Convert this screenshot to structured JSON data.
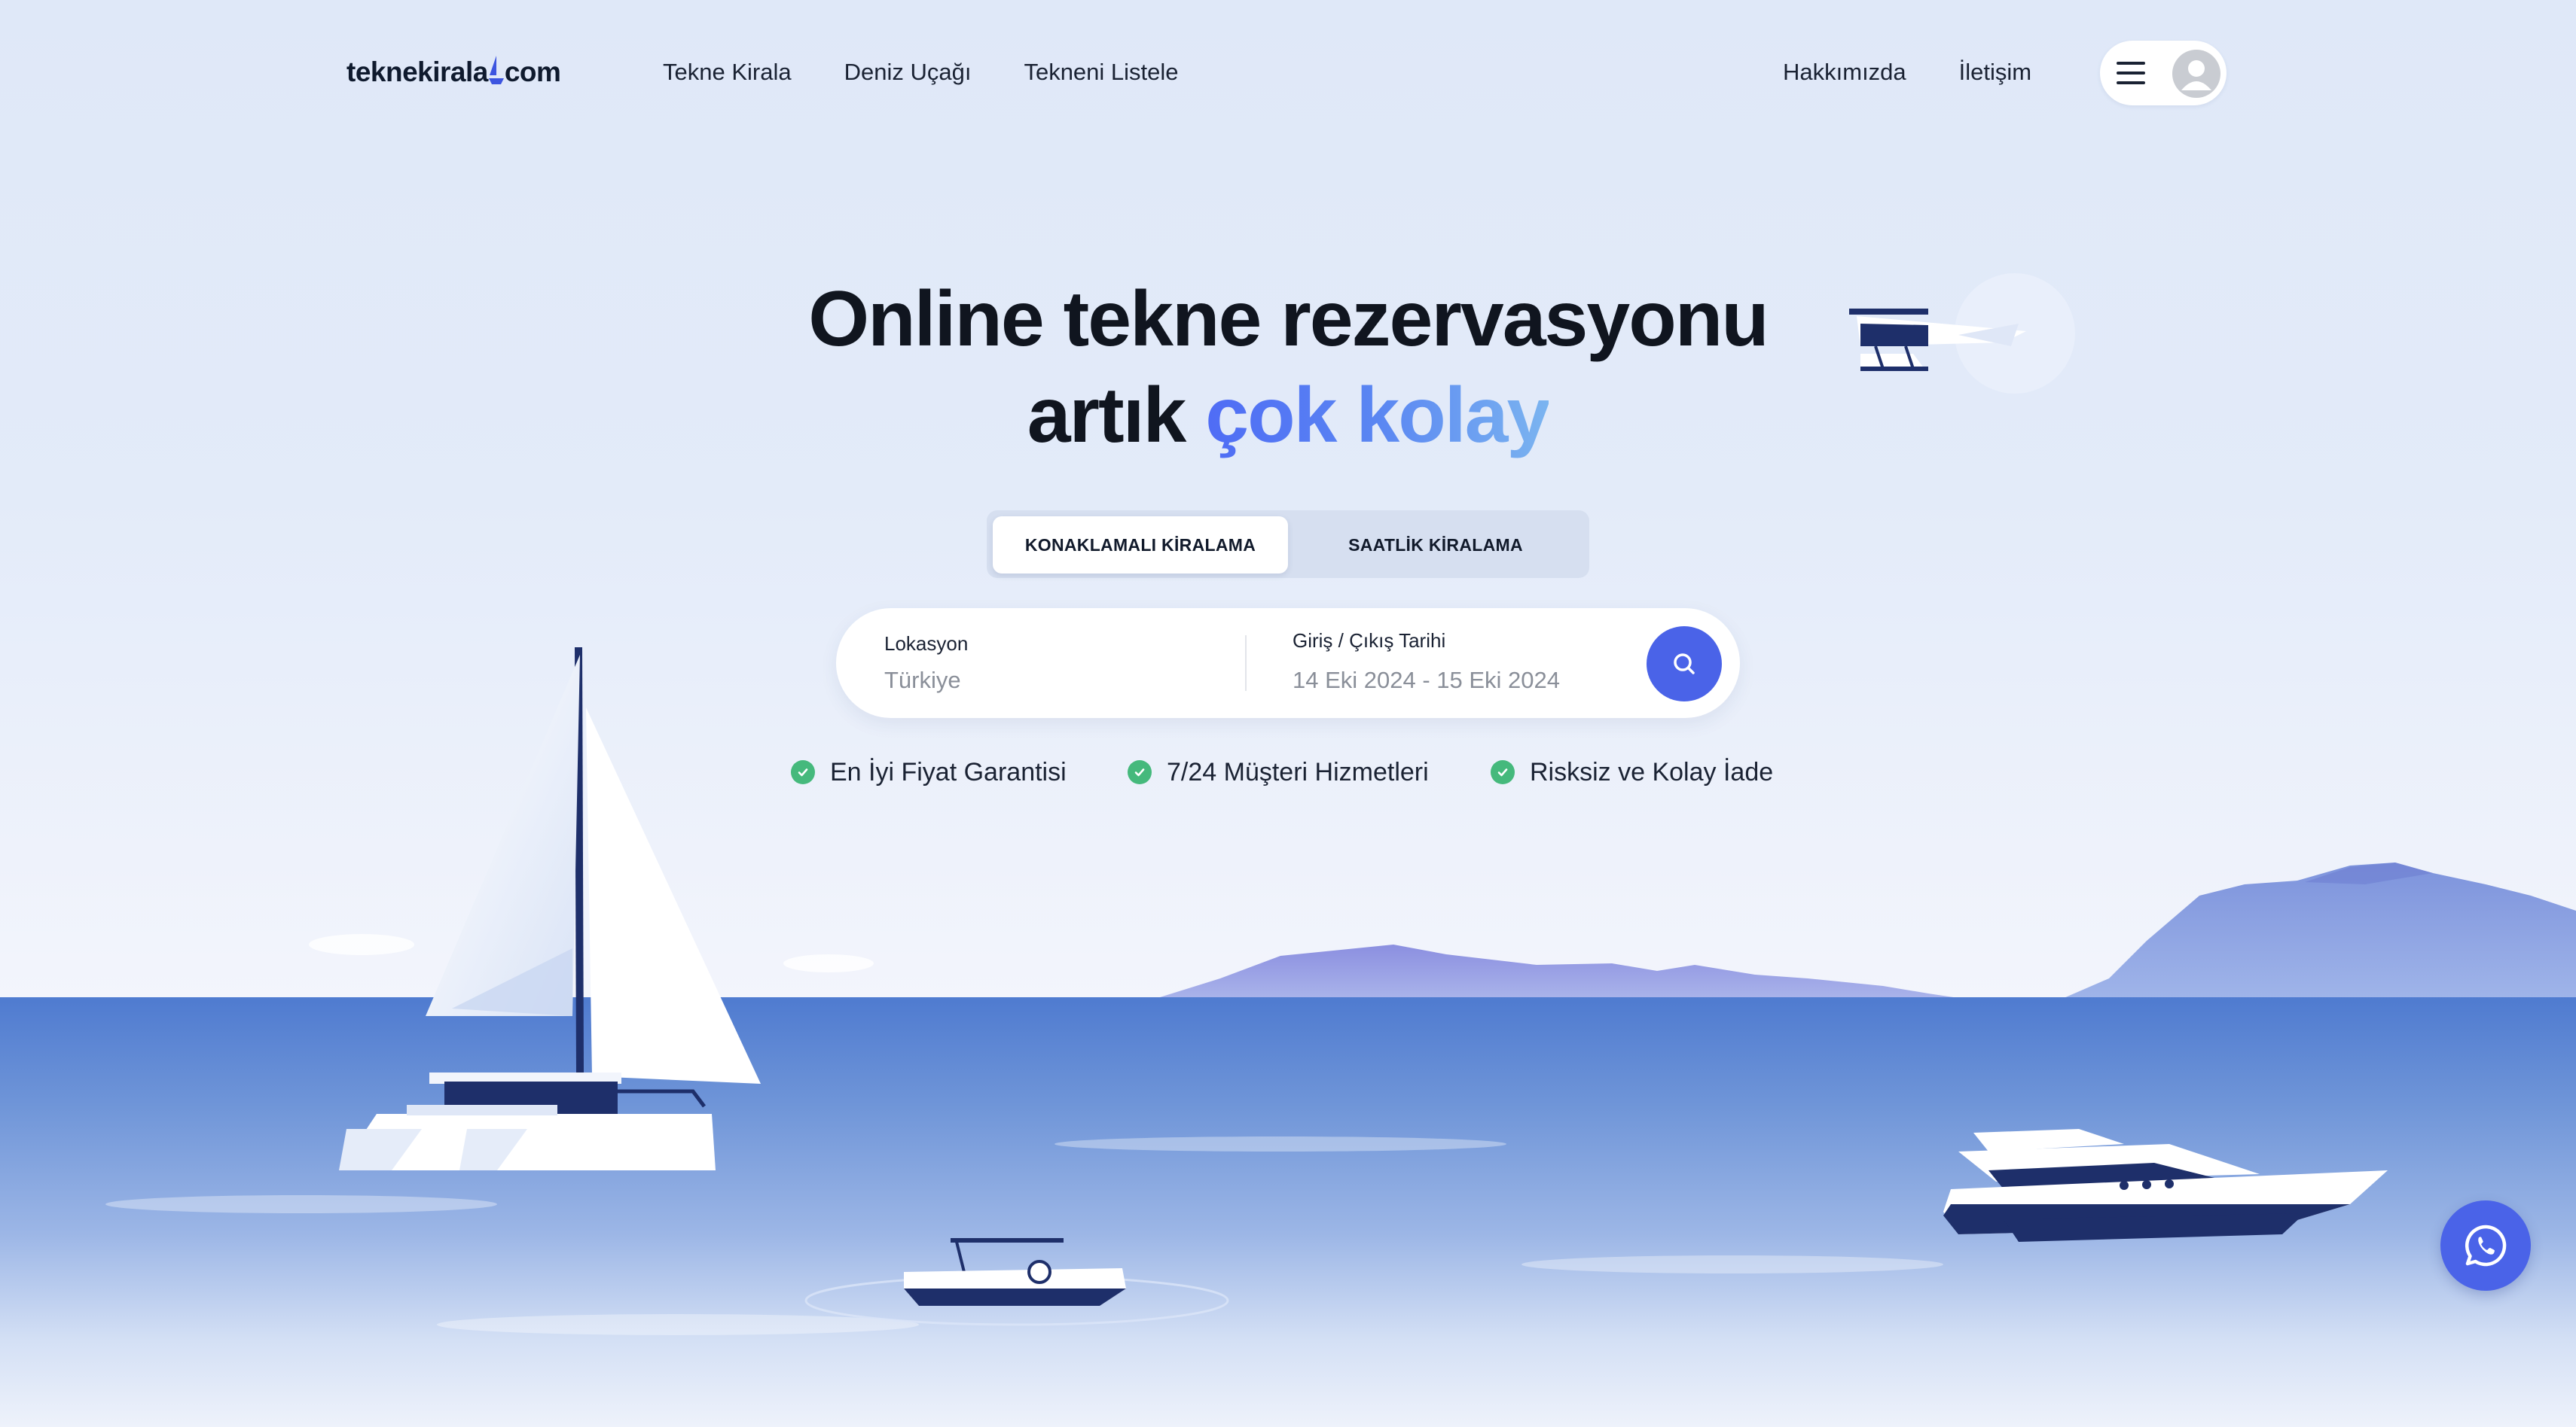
{
  "header": {
    "logo_text": "teknekirala",
    "logo_suffix": "com",
    "nav": [
      "Tekne Kirala",
      "Deniz Uçağı",
      "Tekneni Listele"
    ],
    "nav_right": [
      "Hakkımızda",
      "İletişim"
    ],
    "menu_icon": "hamburger-icon",
    "avatar_icon": "user-avatar-icon"
  },
  "hero": {
    "title_line1": "Online tekne rezervasyonu",
    "title_line2_prefix": "artık ",
    "title_line2_accent": "çok kolay"
  },
  "tabs": [
    {
      "label": "KONAKLAMALI KİRALAMA",
      "active": true
    },
    {
      "label": "SAATLİK KİRALAMA",
      "active": false
    }
  ],
  "search": {
    "location_label": "Lokasyon",
    "location_value": "Türkiye",
    "date_label": "Giriş / Çıkış Tarihi",
    "date_value": "14 Eki 2024 - 15 Eki 2024",
    "button_icon": "search-icon"
  },
  "features": [
    {
      "label": "En İyi Fiyat Garantisi",
      "icon": "check-circle-icon"
    },
    {
      "label": "7/24 Müşteri Hizmetleri",
      "icon": "check-circle-icon"
    },
    {
      "label": "Risksiz ve Kolay İade",
      "icon": "check-circle-icon"
    }
  ],
  "colors": {
    "accent": "#4a63e8",
    "check": "#45b97c",
    "sea": "#6f95d8"
  },
  "whatsapp_icon": "whatsapp-icon"
}
